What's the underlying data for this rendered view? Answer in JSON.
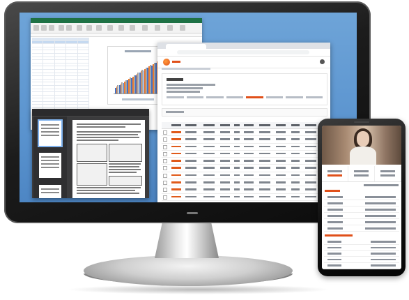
{
  "scene": {
    "kind": "product marketing illustration",
    "note_visible_text": ""
  },
  "excel": {
    "title": "",
    "chart_title": ""
  },
  "pdf_viewer": {
    "file_name": "",
    "page_count": ""
  },
  "browser": {
    "url": "",
    "app_name": "",
    "page_title": ""
  },
  "phone": {
    "tabs": [
      "",
      "",
      ""
    ],
    "section_titles": [
      "",
      ""
    ]
  },
  "colors": {
    "desktop_blue": "#5b94cf",
    "accent_orange": "#e0501a",
    "excel_green": "#1e7145"
  }
}
